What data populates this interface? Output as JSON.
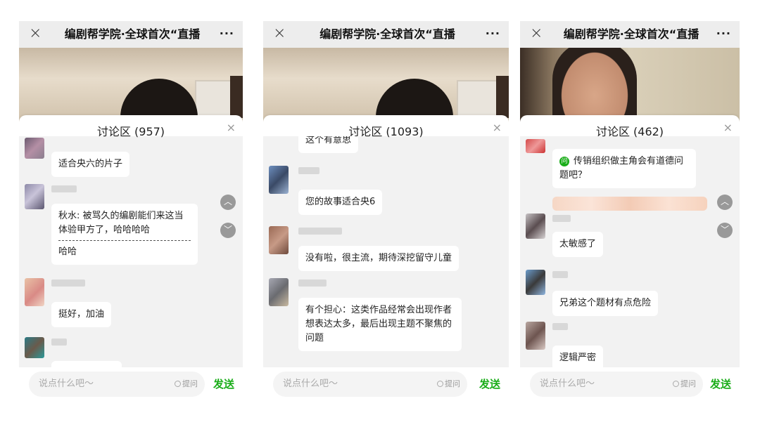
{
  "screens": [
    {
      "title": "编剧帮学院·全球首次“直播",
      "close_icon": "×",
      "more_icon": "···",
      "panel_title": "讨论区 (957)",
      "panel_close_icon": "×",
      "messages": [
        {
          "text": "适合央六的片子"
        },
        {
          "text": "秋水: 被骂久的编剧能们来这当体验甲方了，哈哈哈哈",
          "reply": "哈哈"
        },
        {
          "text": "挺好，加油"
        }
      ],
      "scroll_up_icon": "chevron-up-icon",
      "scroll_down_icon": "chevron-down-icon",
      "input_placeholder": "说点什么吧～",
      "ask_label": "提问",
      "send_label": "发送"
    },
    {
      "title": "编剧帮学院·全球首次“直播",
      "close_icon": "×",
      "more_icon": "···",
      "panel_title": "讨论区 (1093)",
      "panel_close_icon": "×",
      "messages": [
        {
          "text": "这个有意思"
        },
        {
          "text": "您的故事适合央6"
        },
        {
          "text": "没有啦，很主流，期待深挖留守儿童"
        },
        {
          "text": "有个担心：这类作品经常会出现作者想表达太多，最后出现主题不聚焦的问题"
        }
      ],
      "input_placeholder": "说点什么吧～",
      "ask_label": "提问",
      "send_label": "发送"
    },
    {
      "title": "编剧帮学院·全球首次“直播",
      "close_icon": "×",
      "more_icon": "···",
      "panel_title": "讨论区 (462)",
      "panel_close_icon": "×",
      "question_badge": "问",
      "messages": [
        {
          "text": "传销组织做主角会有道德问题吧？"
        },
        {
          "text": "太敏感了"
        },
        {
          "text": "兄弟这个题材有点危险"
        },
        {
          "text": "逻辑严密"
        }
      ],
      "scroll_up_icon": "chevron-up-icon",
      "scroll_down_icon": "chevron-down-icon",
      "input_placeholder": "说点什么吧～",
      "ask_label": "提问",
      "send_label": "发送"
    }
  ],
  "colors": {
    "accent_green": "#1aad19",
    "titlebar_bg": "#ededed",
    "chat_bg": "#f2f2f2"
  }
}
